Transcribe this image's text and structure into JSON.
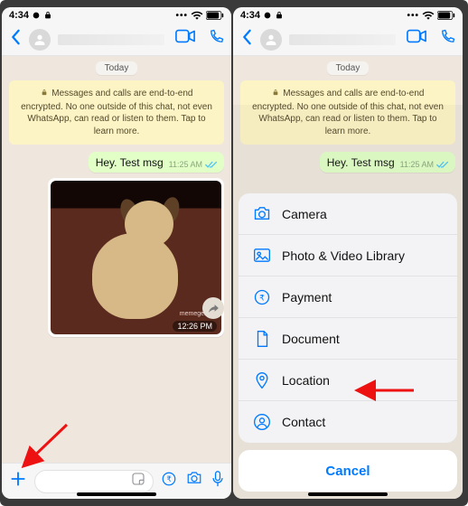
{
  "status": {
    "time": "4:34",
    "alarm": "⏰"
  },
  "header": {
    "contact_name": ""
  },
  "chat": {
    "day_label": "Today",
    "e2e_text": "Messages and calls are end-to-end encrypted. No one outside of this chat, not even WhatsApp, can read or listen to them. Tap to learn more.",
    "msg1": {
      "text": "Hey. Test msg",
      "time": "11:25 AM"
    },
    "img1": {
      "time": "12:26 PM",
      "watermark": "memegenerat"
    }
  },
  "input": {
    "placeholder": ""
  },
  "sheet": {
    "items": [
      {
        "label": "Camera"
      },
      {
        "label": "Photo & Video Library"
      },
      {
        "label": "Payment"
      },
      {
        "label": "Document"
      },
      {
        "label": "Location"
      },
      {
        "label": "Contact"
      }
    ],
    "cancel": "Cancel"
  }
}
